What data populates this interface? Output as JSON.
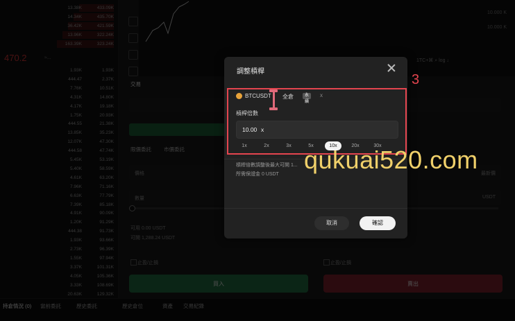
{
  "background": {
    "last_price": "470.2",
    "last_price_sub": "≈...",
    "orderbook_rows": [
      {
        "p": "",
        "q": "13.38K",
        "t": "433.09K"
      },
      {
        "p": "",
        "q": "14.34K",
        "t": "435.70K"
      },
      {
        "p": "",
        "q": "36.42K",
        "t": "421.59K"
      },
      {
        "p": "",
        "q": "13.96K",
        "t": "322.24K"
      },
      {
        "p": "",
        "q": "163.39K",
        "t": "323.24K"
      },
      {
        "p": "",
        "q": "1.93K",
        "t": "1.93K"
      },
      {
        "p": "",
        "q": "444.47",
        "t": "2.37K"
      },
      {
        "p": "",
        "q": "7.76K",
        "t": "10.51K"
      },
      {
        "p": "",
        "q": "4.31K",
        "t": "14.80K"
      },
      {
        "p": "",
        "q": "4.17K",
        "t": "19.18K"
      },
      {
        "p": "",
        "q": "1.75K",
        "t": "20.93K"
      },
      {
        "p": "",
        "q": "444.55",
        "t": "21.38K"
      },
      {
        "p": "",
        "q": "13.85K",
        "t": "35.23K"
      },
      {
        "p": "",
        "q": "12.07K",
        "t": "47.30K"
      },
      {
        "p": "",
        "q": "444.58",
        "t": "47.74K"
      },
      {
        "p": "",
        "q": "5.45K",
        "t": "53.19K"
      },
      {
        "p": "",
        "q": "5.40K",
        "t": "58.59K"
      },
      {
        "p": "",
        "q": "4.61K",
        "t": "63.20K"
      },
      {
        "p": "",
        "q": "7.96K",
        "t": "71.16K"
      },
      {
        "p": "",
        "q": "6.63K",
        "t": "77.79K"
      },
      {
        "p": "",
        "q": "7.39K",
        "t": "85.18K"
      },
      {
        "p": "",
        "q": "4.91K",
        "t": "90.09K"
      },
      {
        "p": "",
        "q": "1.20K",
        "t": "91.29K"
      },
      {
        "p": "",
        "q": "444.38",
        "t": "91.73K"
      },
      {
        "p": "",
        "q": "1.93K",
        "t": "93.66K"
      },
      {
        "p": "",
        "q": "2.73K",
        "t": "96.39K"
      },
      {
        "p": "",
        "q": "1.55K",
        "t": "97.94K"
      },
      {
        "p": "",
        "q": "3.37K",
        "t": "101.31K"
      },
      {
        "p": "",
        "q": "4.05K",
        "t": "105.36K"
      },
      {
        "p": "",
        "q": "3.33K",
        "t": "108.69K"
      },
      {
        "p": "",
        "q": "20.63K",
        "t": "129.32K"
      }
    ],
    "axis_labels": [
      "10.000 K",
      "10.000 K"
    ],
    "toolbar_text": "1TC+⌘   ⌕   log   ↓",
    "tabs_top": [
      "交易"
    ],
    "tabs_mid": [
      "限價委託",
      "市價委託"
    ],
    "field_price": "價格",
    "field_qty": "數量",
    "field_unit_right": "USDT",
    "latest_btn": "最新價",
    "info_left_1": "可用 0.00 USDT",
    "info_left_2": "可開 1,288.24 USDT",
    "checkbox_left": "止盈/止損",
    "checkbox_right": "止盈/止損",
    "btn_buy": "買入",
    "btn_sell": "賣出",
    "bottom_tabs": [
      "持倉情況 (0)",
      "當前委託",
      "歷史委託",
      "歷史倉位",
      "資產",
      "交易紀錄"
    ]
  },
  "modal": {
    "title": "調整槓桿",
    "pair": "BTCUSDT",
    "mode": "全倉",
    "badge": "永續",
    "leverage_label": "槓桿倍數",
    "leverage_value": "10.00",
    "leverage_unit": "x",
    "options": [
      "1x",
      "2x",
      "3x",
      "5x",
      "10x",
      "20x",
      "30x"
    ],
    "selected_option": "10x",
    "info_1": "槓桿倍數調整後最大可開 1...",
    "info_2": "所需保證金 0 USDT",
    "cancel_label": "取消",
    "confirm_label": "確認"
  },
  "annotation": {
    "step": "3",
    "watermark": "qukuai520.com",
    "highlight_color": "#e5454f",
    "watermark_color": "#f0d06a"
  }
}
